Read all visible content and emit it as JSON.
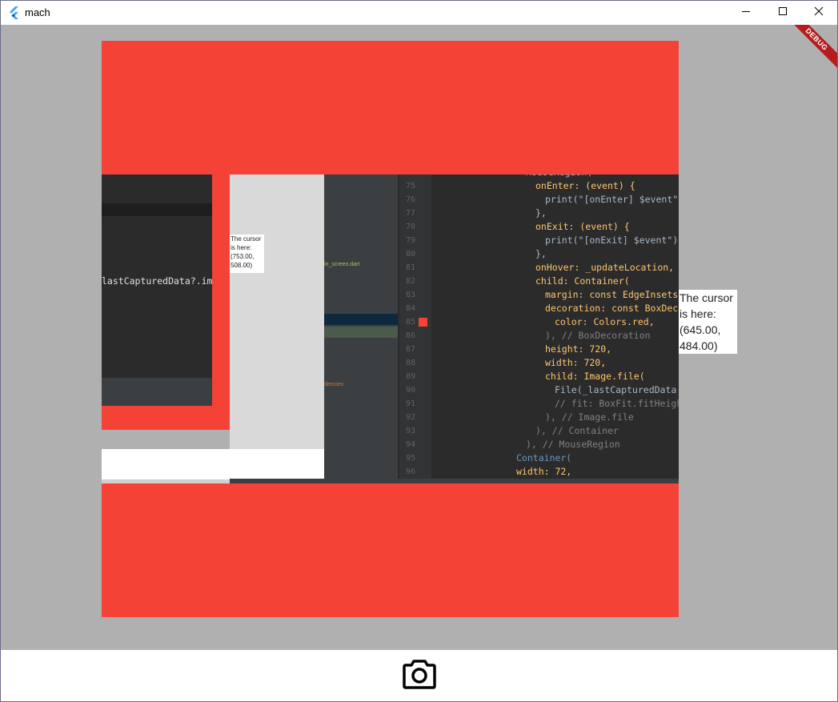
{
  "window": {
    "title": "mach"
  },
  "debug_banner": "DEBUG",
  "cursor_tooltip": {
    "line1": "The cursor",
    "line2": "is here:",
    "line3": "(645.00,",
    "line4": "484.00)"
  },
  "captured": {
    "small_tooltip": {
      "line1": "The cursor",
      "line2": "is here:",
      "line3": "(753.00,",
      "line4": "508.00)"
    },
    "left_code": "lastCapturedData?.imagePa",
    "explorer_file": "in_screen.dart",
    "explorer_deps": "dencies",
    "code_lines": [
      {
        "num": "74",
        "text": "MouseRegion("
      },
      {
        "num": "75",
        "text": "onEnter: (event) {"
      },
      {
        "num": "76",
        "text": "print(\"[onEnter] $event\");"
      },
      {
        "num": "77",
        "text": "},"
      },
      {
        "num": "78",
        "text": "onExit: (event) {"
      },
      {
        "num": "79",
        "text": "print(\"[onExit] $event\");"
      },
      {
        "num": "80",
        "text": "},"
      },
      {
        "num": "81",
        "text": "onHover: _updateLocation,"
      },
      {
        "num": "82",
        "text": "child: Container("
      },
      {
        "num": "83",
        "text": "margin: const EdgeInsets.o"
      },
      {
        "num": "84",
        "text": "decoration: const BoxDecor"
      },
      {
        "num": "85",
        "text": "color: Colors.red,"
      },
      {
        "num": "86",
        "text": "),  // BoxDecoration"
      },
      {
        "num": "87",
        "text": "height: 720,"
      },
      {
        "num": "88",
        "text": "width: 720,"
      },
      {
        "num": "89",
        "text": "child: Image.file("
      },
      {
        "num": "90",
        "text": "File(_lastCapturedData!."
      },
      {
        "num": "91",
        "text": "// fit: BoxFit.fitHeight"
      },
      {
        "num": "92",
        "text": "),  // Image.file"
      },
      {
        "num": "93",
        "text": "),  // Container"
      },
      {
        "num": "94",
        "text": "),  // MouseRegion"
      },
      {
        "num": "95",
        "text": "Container("
      },
      {
        "num": "96",
        "text": "width: 72,"
      }
    ]
  },
  "icons": {
    "app": "flutter-logo-icon",
    "minimize": "minimize-icon",
    "maximize": "maximize-icon",
    "close": "close-icon",
    "camera": "camera-icon"
  },
  "colors": {
    "accent_red": "#f44336",
    "background_gray": "#b0b0b0",
    "editor_bg": "#2b2b2b"
  }
}
